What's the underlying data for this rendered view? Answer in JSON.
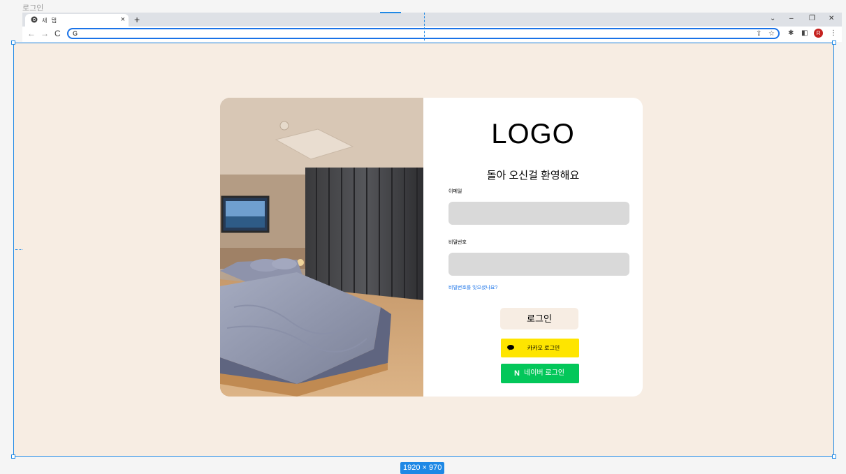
{
  "frame": {
    "name": "로그인",
    "size_label": "1920 × 970"
  },
  "browser": {
    "tab_title": "새 탭",
    "tab_close": "×",
    "new_tab": "+",
    "window_controls": [
      "⌄",
      "–",
      "❐",
      "✕"
    ],
    "nav": [
      "←",
      "→",
      "C"
    ],
    "omnibox_icon": "G",
    "profile_initial": "R"
  },
  "login": {
    "logo": "LOGO",
    "welcome": "돌아 오신걸 환영해요",
    "email_label": "이메일",
    "password_label": "비밀번호",
    "forgot_password": "비밀번호를 잊으셨나요?",
    "login_button": "로그인",
    "kakao_button": "카카오 로그인",
    "naver_button": "네이버 로그인",
    "naver_mark": "N"
  },
  "colors": {
    "canvas_bg": "#f7ede3",
    "kakao": "#fee500",
    "naver": "#03c75a",
    "input_bg": "#d9d9d9",
    "selection": "#1e88e5"
  }
}
